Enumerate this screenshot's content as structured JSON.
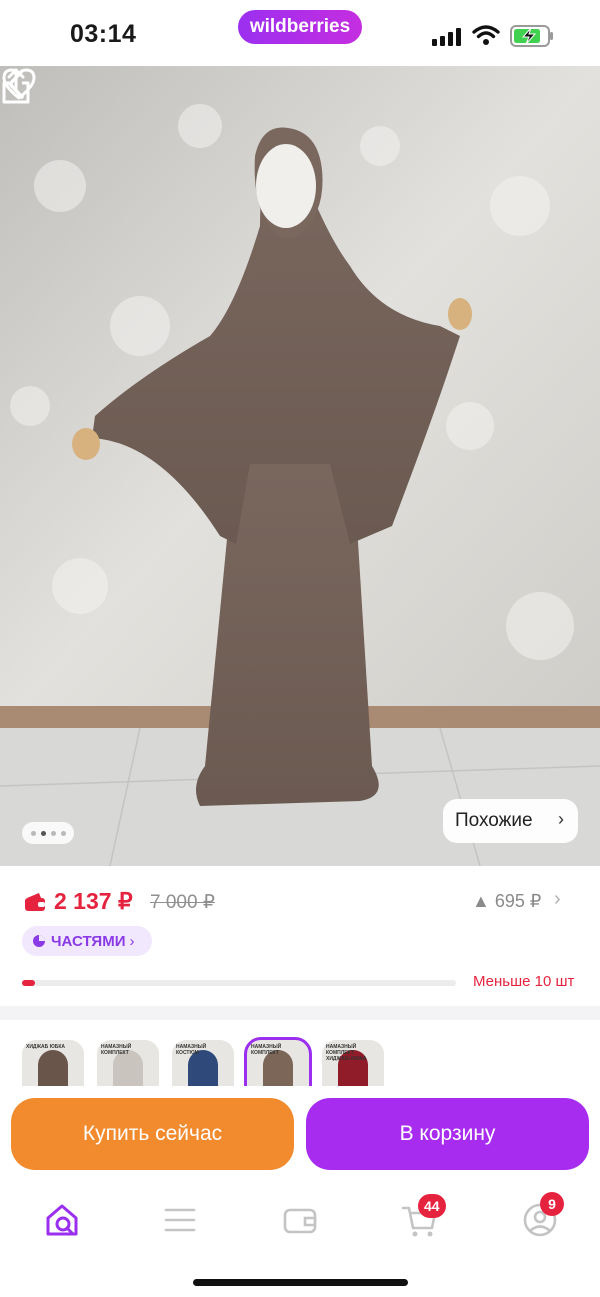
{
  "status_bar": {
    "time": "03:14",
    "brand": "wildberries"
  },
  "product": {
    "similar_label": "Похожие",
    "gallery_dots": 4,
    "gallery_active": 1
  },
  "price": {
    "current": "2 137 ₽",
    "old": "7 000 ₽",
    "increase": "695 ₽",
    "installments_label": "ЧАСТЯМИ",
    "stock_text": "Меньше 10 шт",
    "stock_level": 0.03
  },
  "variants": [
    {
      "caption": "ХИДЖАБ ЮБКА",
      "color": "#6a554a"
    },
    {
      "caption": "НАМАЗНЫЙ КОМПЛЕКТ",
      "color": "#c9c4bd"
    },
    {
      "caption": "НАМАЗНЫЙ КОСТЮМ",
      "color": "#2f4a7a"
    },
    {
      "caption": "НАМАЗНЫЙ КОМПЛЕКТ",
      "color": "#7b6658",
      "selected": true
    },
    {
      "caption": "НАМАЗНЫЙ КОМПЛЕКТ ХИДЖАБ+ЮБКА",
      "color": "#8f1c28"
    }
  ],
  "actions": {
    "buy_now": "Купить сейчас",
    "add_to_cart": "В корзину"
  },
  "tabbar": {
    "cart_badge": "44",
    "profile_badge": "9"
  },
  "colors": {
    "accent": "#a82cf0",
    "buy": "#f28a2e",
    "price": "#e5233f"
  }
}
